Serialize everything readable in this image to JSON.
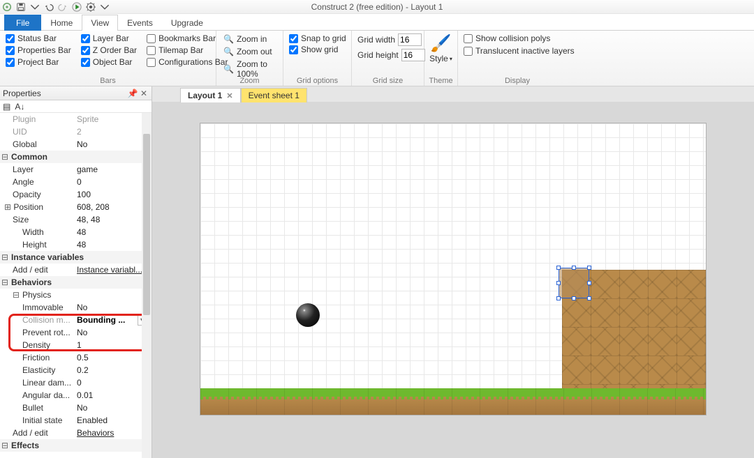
{
  "app": {
    "title": "Construct 2  (free edition) - Layout 1"
  },
  "tabs": {
    "file": "File",
    "home": "Home",
    "view": "View",
    "events": "Events",
    "upgrade": "Upgrade"
  },
  "ribbon": {
    "bars": {
      "label": "Bars",
      "col1": [
        [
          "Status Bar",
          true
        ],
        [
          "Properties Bar",
          true
        ],
        [
          "Project Bar",
          true
        ]
      ],
      "col2": [
        [
          "Layer Bar",
          true
        ],
        [
          "Z Order Bar",
          true
        ],
        [
          "Object Bar",
          true
        ]
      ],
      "col3": [
        [
          "Bookmarks Bar",
          false
        ],
        [
          "Tilemap Bar",
          false
        ],
        [
          "Configurations Bar",
          false
        ]
      ]
    },
    "zoom": {
      "label": "Zoom",
      "in": "Zoom in",
      "out": "Zoom out",
      "to100": "Zoom to 100%"
    },
    "gridopts": {
      "label": "Grid options",
      "snap": [
        "Snap to grid",
        true
      ],
      "show": [
        "Show grid",
        true
      ]
    },
    "gridsize": {
      "label": "Grid size",
      "w_label": "Grid width",
      "w_val": "16",
      "h_label": "Grid height",
      "h_val": "16"
    },
    "theme": {
      "label": "Theme",
      "style": "Style"
    },
    "display": {
      "label": "Display",
      "poly": [
        "Show collision polys",
        false
      ],
      "trans": [
        "Translucent inactive layers",
        false
      ]
    }
  },
  "doctabs": {
    "layout": "Layout 1",
    "event": "Event sheet 1"
  },
  "props": {
    "title": "Properties",
    "rows": {
      "plugin_k": "Plugin",
      "plugin_v": "Sprite",
      "uid_k": "UID",
      "uid_v": "2",
      "global_k": "Global",
      "global_v": "No",
      "common": "Common",
      "layer_k": "Layer",
      "layer_v": "game",
      "angle_k": "Angle",
      "angle_v": "0",
      "opacity_k": "Opacity",
      "opacity_v": "100",
      "pos_k": "Position",
      "pos_v": "608, 208",
      "size_k": "Size",
      "size_v": "48, 48",
      "width_k": "Width",
      "width_v": "48",
      "height_k": "Height",
      "height_v": "48",
      "ivars": "Instance variables",
      "addedit": "Add / edit",
      "ivars_link": "Instance variabl...",
      "behaviors": "Behaviors",
      "physics": "Physics",
      "immovable_k": "Immovable",
      "immovable_v": "No",
      "collm_k": "Collision m...",
      "collm_v": "Bounding ...",
      "prevent_k": "Prevent rot...",
      "prevent_v": "No",
      "density_k": "Density",
      "density_v": "1",
      "friction_k": "Friction",
      "friction_v": "0.5",
      "elasticity_k": "Elasticity",
      "elasticity_v": "0.2",
      "lindamp_k": "Linear dam...",
      "lindamp_v": "0",
      "angdamp_k": "Angular da...",
      "angdamp_v": "0.01",
      "bullet_k": "Bullet",
      "bullet_v": "No",
      "inistate_k": "Initial state",
      "inistate_v": "Enabled",
      "beh_link": "Behaviors",
      "effects": "Effects"
    }
  }
}
